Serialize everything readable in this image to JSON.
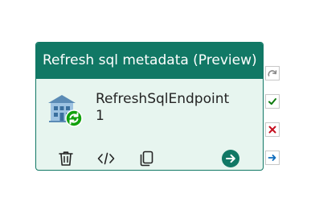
{
  "activity": {
    "title": "Refresh sql metadata (Preview)",
    "name": "RefreshSqlEndpoint\n1",
    "icon": "sql-endpoint-refresh-icon"
  },
  "toolbar": {
    "icons": [
      "trash-icon",
      "code-icon",
      "copy-icon",
      "arrow-right-circle-icon"
    ]
  },
  "side_connectors": {
    "icons": [
      "skip-arrow-icon",
      "checkmark-icon",
      "cross-icon",
      "completion-arrow-icon"
    ]
  },
  "colors": {
    "header": "#117865",
    "body": "#e7f5ef",
    "success": "#107c10",
    "failure": "#c50f1f",
    "completion": "#0f6cbd",
    "skip": "#8a8a8a"
  }
}
